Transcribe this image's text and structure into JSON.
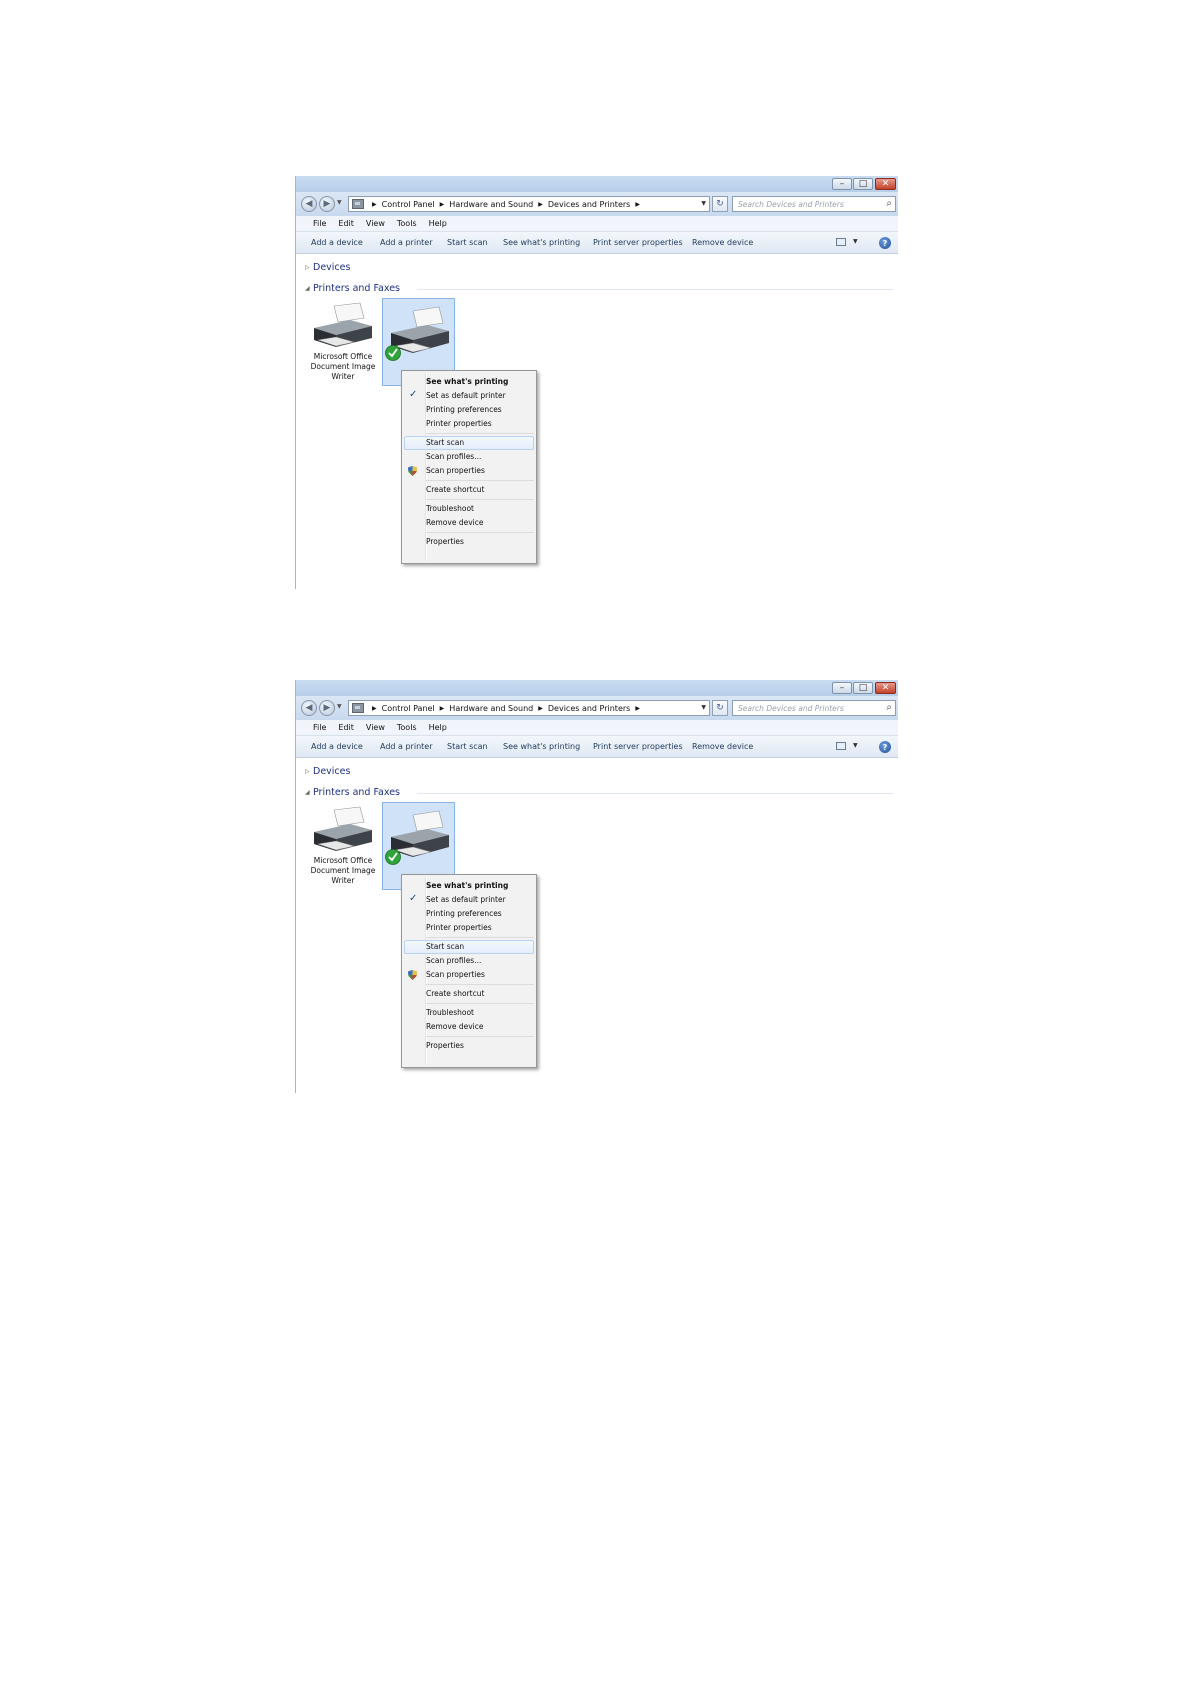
{
  "window": {
    "breadcrumbs": [
      "Control Panel",
      "Hardware and Sound",
      "Devices and Printers"
    ],
    "search_placeholder": "Search Devices and Printers",
    "menu": [
      "File",
      "Edit",
      "View",
      "Tools",
      "Help"
    ],
    "commands": [
      "Add a device",
      "Add a printer",
      "Start scan",
      "See what's printing",
      "Print server properties",
      "Remove device"
    ],
    "groups": {
      "devices": "Devices",
      "printers": "Printers and Faxes"
    },
    "device1_label": "Microsoft Office\nDocument Image\nWriter",
    "context_menu": [
      "See what's printing",
      "Set as default printer",
      "Printing preferences",
      "Printer properties",
      "Start scan",
      "Scan profiles...",
      "Scan properties",
      "Create shortcut",
      "Troubleshoot",
      "Remove device",
      "Properties"
    ],
    "icons": {
      "back": "back-arrow-icon",
      "forward": "forward-arrow-icon",
      "refresh": "refresh-icon",
      "search": "search-icon",
      "help": "help-icon",
      "check": "checkmark-icon",
      "shield": "uac-shield-icon"
    },
    "colors": {
      "title_bar": "#c9dcf1",
      "selection": "#cfe2f7",
      "group_heading": "#1e3287",
      "command_text": "#1e395b"
    }
  }
}
